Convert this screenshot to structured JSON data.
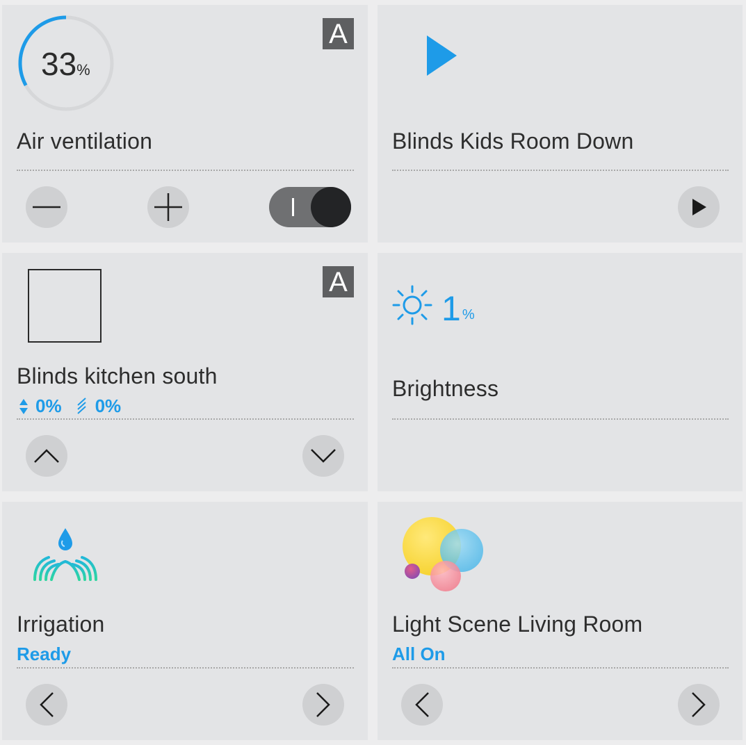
{
  "tiles": {
    "air_ventilation": {
      "title": "Air ventilation",
      "value": "33",
      "unit": "%",
      "level_fraction": 0.33,
      "badge": "A",
      "switch_on": true
    },
    "blinds_kids": {
      "title": "Blinds Kids Room Down"
    },
    "blinds_kitchen": {
      "title": "Blinds kitchen south",
      "badge": "A",
      "position": "0%",
      "slat": "0%"
    },
    "brightness": {
      "title": "Brightness",
      "value": "1",
      "unit": "%"
    },
    "irrigation": {
      "title": "Irrigation",
      "status": "Ready"
    },
    "light_scene": {
      "title": "Light Scene Living Room",
      "status": "All On"
    }
  },
  "colors": {
    "accent": "#1e9be8",
    "tile_bg": "#e3e4e6",
    "page_bg": "#ededee",
    "badge_bg": "#5e5f61",
    "button_bg": "#cfd0d2"
  },
  "icons": {
    "air_ventilation": "circular-gauge",
    "blinds_kids": "play-icon",
    "blinds_kitchen": "blind-window-icon",
    "brightness": "sun-icon",
    "irrigation": "sprinkler-icon",
    "light_scene": "color-bubbles-icon"
  }
}
